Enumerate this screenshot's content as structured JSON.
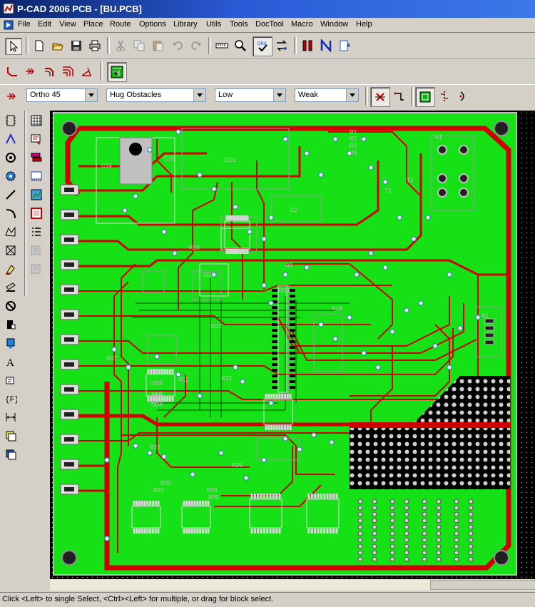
{
  "window": {
    "title": "P-CAD 2006 PCB - [BU.PCB]"
  },
  "menu": [
    "File",
    "Edit",
    "View",
    "Place",
    "Route",
    "Options",
    "Library",
    "Utils",
    "Tools",
    "DocTool",
    "Macro",
    "Window",
    "Help"
  ],
  "route_toolbar": {
    "mode": "Ortho 45",
    "obstacle": "Hug Obstacles",
    "level": "Low",
    "strength": "Weak"
  },
  "toolbar_labels": {
    "drc": "DRC"
  },
  "status": "Click <Left> to single Select, <Ctrl><Left> for multiple, or drag for block select.",
  "colors": {
    "board": "#16e016",
    "trace": "#d00000",
    "copper_edge": "#d00000",
    "background": "#000000"
  },
  "icons": {
    "main": [
      "select-arrow-icon",
      "new-icon",
      "open-icon",
      "save-icon",
      "print-icon",
      "cut-icon",
      "copy-icon",
      "paste-icon",
      "undo-icon",
      "redo-icon",
      "measure-icon",
      "zoom-icon",
      "drc-icon",
      "compare-icon",
      "red-bars-icon",
      "blue-n-icon",
      "text-icon"
    ],
    "route": [
      "route-manual-icon",
      "route-interactive-icon",
      "route-bus-icon",
      "route-multi-icon",
      "route-fanout-icon",
      "pcb-view-icon"
    ],
    "left": [
      "place-component-icon",
      "place-connection-icon",
      "place-pad-icon",
      "place-via-icon",
      "place-line-icon",
      "place-arc-icon",
      "place-polygon-icon",
      "place-copper-pour-icon",
      "place-fill-icon",
      "place-keepout-icon",
      "place-cutout-icon",
      "place-plane-icon",
      "place-point-icon",
      "place-text-icon",
      "place-attribute-icon",
      "place-field-icon",
      "place-dimension-icon",
      "place-room-icon",
      "place-pattern-icon",
      "place-grid-icon",
      "place-route-icon",
      "place-layer-icon",
      "place-table-icon",
      "place-overlay-icon",
      "place-bitmap-icon",
      "place-list-icon",
      "place-disabled-icon",
      "place-disabled-icon-2"
    ]
  },
  "board_labels": [
    "C14",
    "C15",
    "DD1",
    "C2",
    "DD2",
    "DD3",
    "DD4",
    "DD5",
    "DD6",
    "DD7",
    "DD8",
    "R1",
    "R2",
    "R3",
    "R4",
    "R9",
    "R10",
    "R12",
    "R13",
    "R18",
    "R22",
    "R25",
    "R27",
    "R31",
    "R32",
    "R33",
    "R35",
    "X1",
    "K1",
    "T1",
    "T2"
  ]
}
